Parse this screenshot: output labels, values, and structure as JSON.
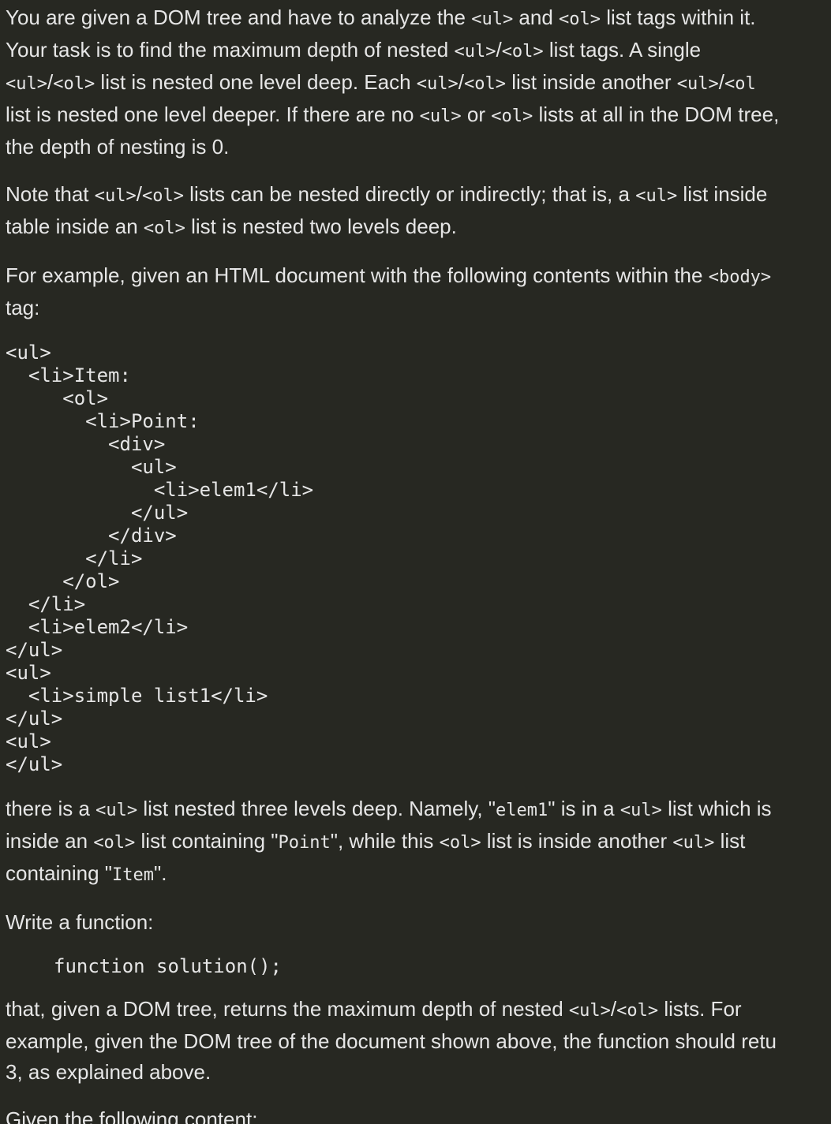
{
  "intro": {
    "line1": {
      "a": "You are given a DOM tree and have to analyze the ",
      "ul": "<ul>",
      "b": " and ",
      "ol": "<ol>",
      "c": " list tags within it."
    },
    "line2": {
      "a": "Your task is to find the maximum depth of nested ",
      "ul": "<ul>",
      "slash": "/",
      "ol": "<ol>",
      "b": " list tags. A single"
    },
    "line3": {
      "ul": "<ul>",
      "slash": "/",
      "ol": "<ol>",
      "a": " list is nested one level deep. Each ",
      "ul2": "<ul>",
      "slash2": "/",
      "ol2": "<ol>",
      "b": " list inside another ",
      "ul3": "<ul>",
      "slash3": "/",
      "ol3": "<ol"
    },
    "line4": {
      "a": "list is nested one level deeper. If there are no ",
      "ul": "<ul>",
      "b": " or ",
      "ol": "<ol>",
      "c": " lists at all in the DOM tree,"
    },
    "line5": "the depth of nesting is 0."
  },
  "note": {
    "line1": {
      "a": "Note that ",
      "ul": "<ul>",
      "slash": "/",
      "ol": "<ol>",
      "b": " lists can be nested directly or indirectly; that is, a ",
      "ul2": "<ul>",
      "c": " list inside"
    },
    "line2": {
      "a": "table inside an ",
      "ol": "<ol>",
      "b": " list is nested two levels deep."
    }
  },
  "example_intro": {
    "line1": {
      "a": "For example, given an HTML document with the following contents within the ",
      "body": "<body>"
    },
    "line2": "tag:"
  },
  "code_block": "<ul>\n  <li>Item:\n     <ol>\n       <li>Point:\n         <div>\n           <ul>\n             <li>elem1</li>\n           </ul>\n         </div>\n       </li>\n     </ol>\n  </li>\n  <li>elem2</li>\n</ul>\n<ul>\n  <li>simple list1</li>\n</ul>\n<ul>\n</ul>",
  "explanation": {
    "line1": {
      "a": "there is a ",
      "ul": "<ul>",
      "b": " list nested three levels deep. Namely, \"",
      "elem1": "elem1",
      "c": "\" is in a ",
      "ul2": "<ul>",
      "d": " list which is"
    },
    "line2": {
      "a": "inside an ",
      "ol": "<ol>",
      "b": " list containing \"",
      "point": "Point",
      "c": "\", while this ",
      "ol2": "<ol>",
      "d": " list is inside another ",
      "ul": "<ul>",
      "e": " list"
    },
    "line3": {
      "a": "containing \"",
      "item": "Item",
      "b": "\"."
    }
  },
  "write_function": "Write a function:",
  "signature": "function solution();",
  "returns": {
    "line1": {
      "a": "that, given a DOM tree, returns the maximum depth of nested ",
      "ul": "<ul>",
      "slash": "/",
      "ol": "<ol>",
      "b": " lists. For"
    },
    "line2": "example, given the DOM tree of the document shown above, the function should retu",
    "line3": "3, as explained above."
  },
  "given_content": "Given the following content:"
}
